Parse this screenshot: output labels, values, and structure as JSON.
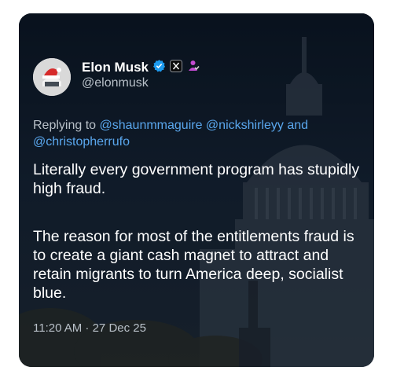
{
  "post": {
    "author_name": "Elon Musk",
    "handle": "@elonmusk",
    "reply_prefix": "Replying to",
    "mentions": [
      "@shaunmmaguire",
      "@nickshirleyy",
      "@christopherrufo"
    ],
    "reply_joiner": "and",
    "paragraphs": [
      "Literally every government program has stupidly high fraud.",
      "The reason for most of the entitlements fraud is to create a giant cash magnet to attract and retain migrants to turn America deep, socialist blue."
    ],
    "timestamp": "11:20 AM · 27 Dec 25"
  },
  "icons": {
    "verified": "verified-badge-icon",
    "x_logo": "x-logo-icon",
    "affiliate": "affiliate-icon"
  },
  "colors": {
    "card_bg": "#0f1a28",
    "mention": "#5aa7ee",
    "verified": "#1d9bf0",
    "affiliate": "#c24bd1",
    "secondary_text": "#b8c0c8"
  }
}
